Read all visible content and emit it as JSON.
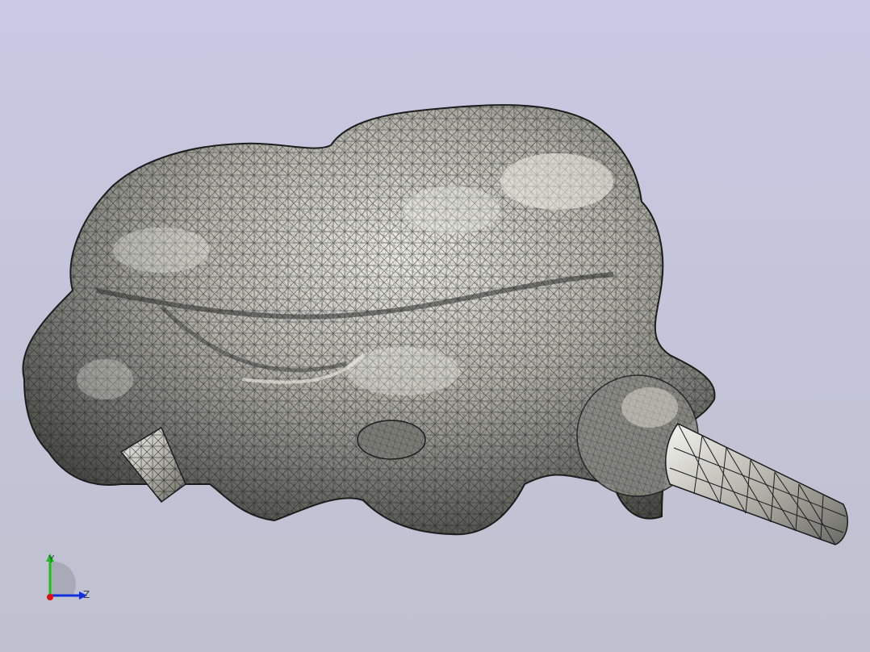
{
  "viewport": {
    "background_top": "#c9c9e3",
    "background_bottom": "#bfc1cf",
    "mesh_fill": "#9b9b94",
    "mesh_highlight": "#efefe8",
    "mesh_edge": "#1a1a1a"
  },
  "triad": {
    "y_label": "Y",
    "z_label": "Z",
    "x_color": "#e01010",
    "y_color": "#18c018",
    "z_color": "#1030e0"
  }
}
